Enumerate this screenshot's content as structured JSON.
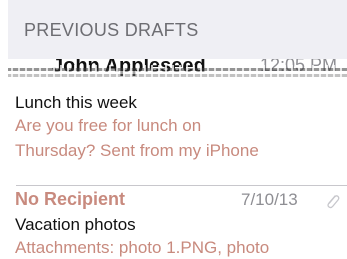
{
  "section": {
    "title": "PREVIOUS DRAFTS"
  },
  "drafts": [
    {
      "sender": "John Appleseed",
      "time": "12:05 PM",
      "subject": "Lunch this week",
      "preview_line_1": "Are you free for lunch on",
      "preview_line_2": "Thursday? Sent from my iPhone"
    },
    {
      "sender": "No Recipient",
      "date": "7/10/13",
      "subject": "Vacation photos",
      "preview": "Attachments: photo 1.PNG, photo",
      "attachment_icon": "paperclip-icon"
    }
  ],
  "colors": {
    "header_background": "#efeff4",
    "header_text": "#6d6d72",
    "accent": "#c88a7e",
    "secondary_text": "#8e8e93",
    "divider": "#c8c7cc"
  }
}
